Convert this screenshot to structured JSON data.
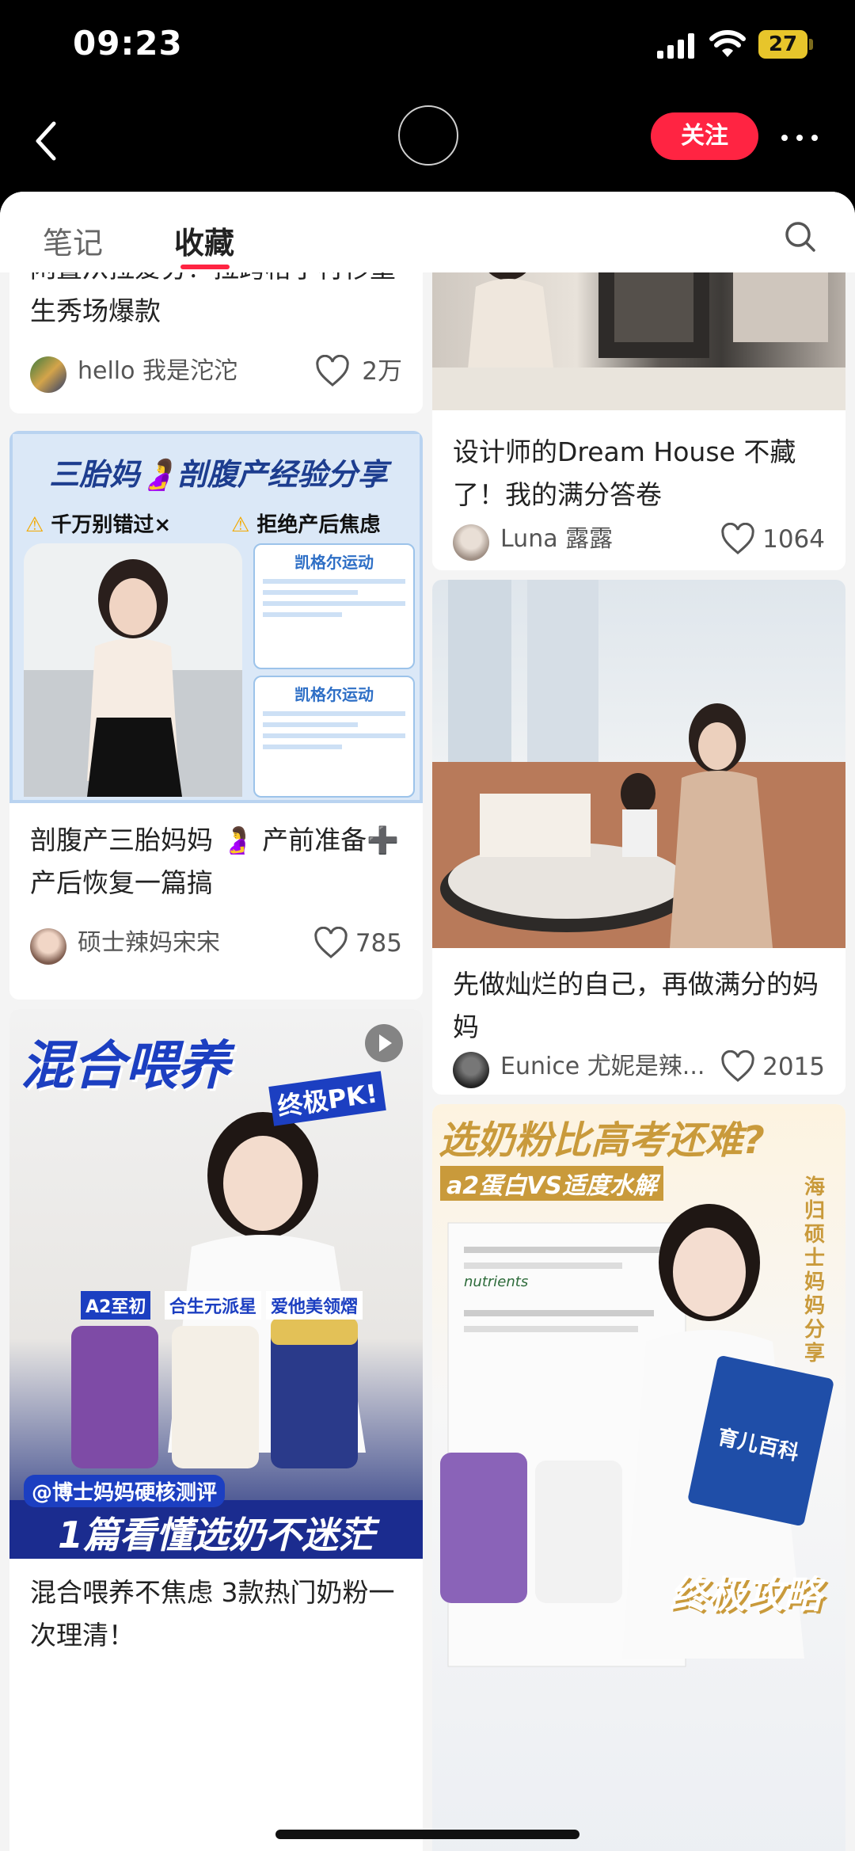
{
  "status": {
    "time": "09:23",
    "battery": "27"
  },
  "nav": {
    "follow_label": "关注"
  },
  "tabs": [
    {
      "label": "笔记"
    },
    {
      "label": "收藏"
    }
  ],
  "cards": [
    {
      "title": "闲置从拉爱穷！拉跨格子衬衫重生秀场爆款",
      "author": "hello 我是沱沱",
      "likes": "2万"
    },
    {
      "title": "设计师的Dream House 不藏了！我的满分答卷",
      "author": "Luna 露露",
      "likes": "1064"
    },
    {
      "title": "剖腹产三胎妈妈 🤰 产前准备➕产后恢复一篇搞",
      "author": "硕士辣妈宋宋",
      "likes": "785",
      "image_text": {
        "headline": "三胎妈🤰剖腹产经验分享",
        "tip_left": "千万别错过×",
        "tip_right": "拒绝产后焦虑",
        "panel_title_1": "凯格尔运动",
        "panel_title_2": "凯格尔运动"
      }
    },
    {
      "title": "先做灿烂的自己，再做满分的妈妈",
      "author": "Eunice 尤妮是辣...",
      "likes": "2015"
    },
    {
      "title": "混合喂养不焦虑 3款热门奶粉一次理清！",
      "image_text": {
        "headline": "混合喂养",
        "subhead": "终极PK!",
        "labels": [
          "A2至初",
          "合生元派星",
          "爱他美领熠"
        ],
        "byline": "@博士妈妈硬核测评",
        "bottom": "1篇看懂选奶不迷茫"
      }
    },
    {
      "image_text": {
        "headline": "选奶粉比高考还难?",
        "subhead": "a2蛋白VS适度水解",
        "side": "海归硕士妈妈分享",
        "journal": "nutrients",
        "book": "育儿百科",
        "bottom": "终极攻略"
      }
    }
  ]
}
